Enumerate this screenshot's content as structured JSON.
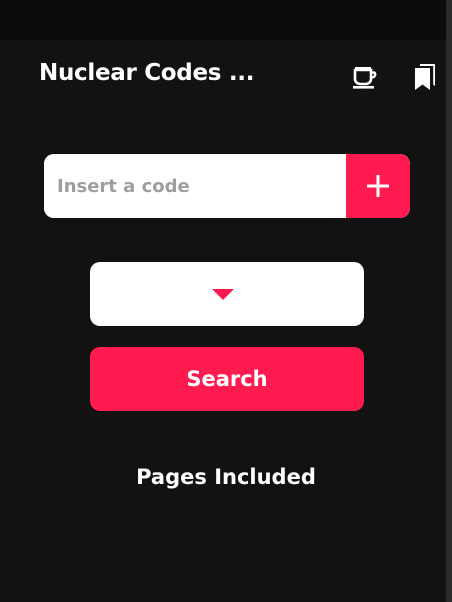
{
  "header": {
    "title": "Nuclear Codes ...",
    "icons": [
      "coffee-icon",
      "bookmarks-icon"
    ]
  },
  "code_input": {
    "value": "",
    "placeholder": "Insert a code",
    "add_icon": "plus-icon"
  },
  "selector": {
    "value": "",
    "arrow_icon": "dropdown-arrow-icon"
  },
  "search_button": {
    "label": "Search"
  },
  "pages_section": {
    "heading": "Pages Included"
  },
  "colors": {
    "background": "#121212",
    "accent": "#ff1a4f",
    "surface": "#ffffff",
    "text_on_dark": "#ffffff",
    "placeholder": "#9e9e9e"
  }
}
